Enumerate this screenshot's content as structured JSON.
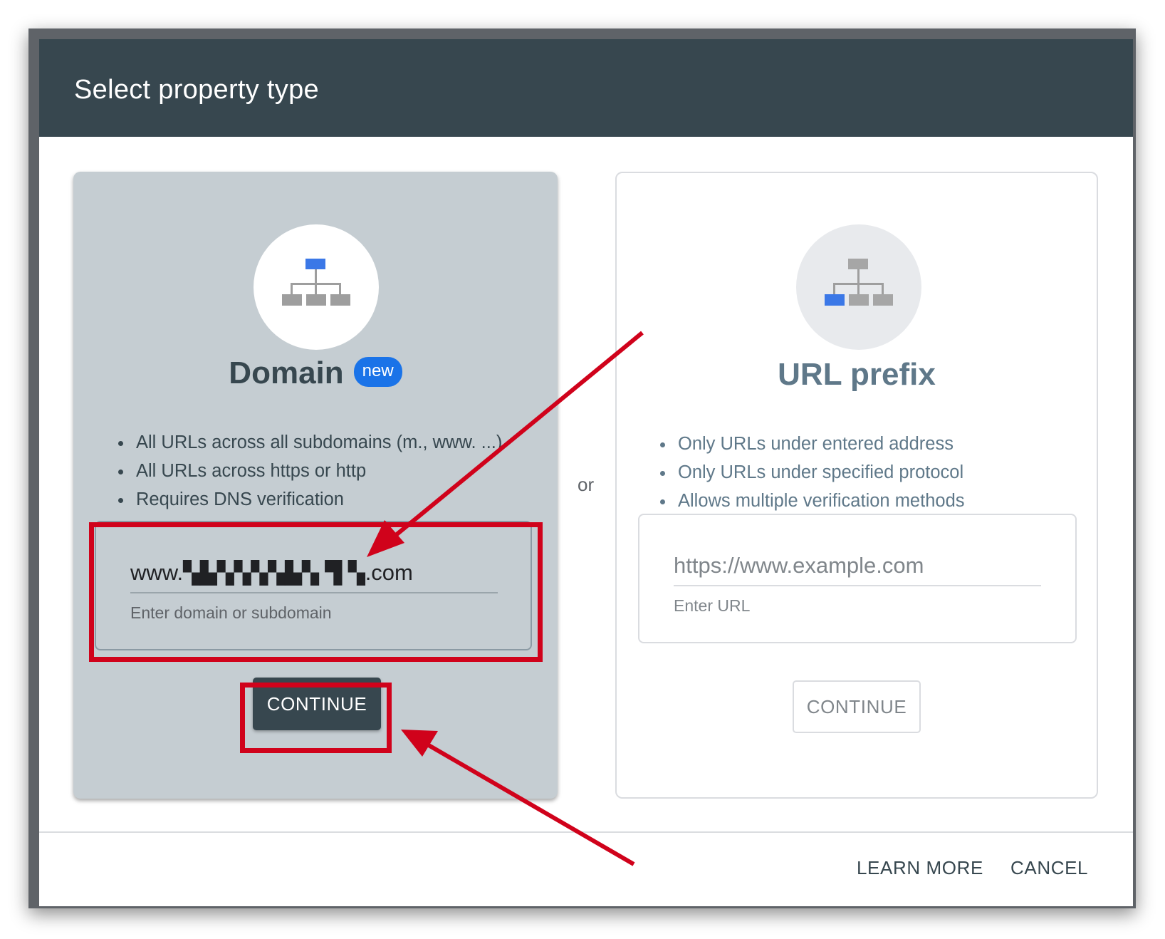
{
  "dialog": {
    "title": "Select property type"
  },
  "domain_card": {
    "title": "Domain",
    "badge": "new",
    "features": [
      "All URLs across all subdomains (m., www. ...)",
      "All URLs across https or http",
      "Requires DNS verification"
    ],
    "input_value": "www.▚▙▚▚▚▚▙▚ ▜ ▚.com",
    "input_helper": "Enter domain or subdomain",
    "continue_label": "CONTINUE",
    "icon": "sitemap-icon",
    "highlight_color": "#1a73e8"
  },
  "separator": "or",
  "url_card": {
    "title": "URL prefix",
    "features": [
      "Only URLs under entered address",
      "Only URLs under specified protocol",
      "Allows multiple verification methods"
    ],
    "input_placeholder": "https://www.example.com",
    "input_helper": "Enter URL",
    "continue_label": "CONTINUE",
    "icon": "sitemap-icon"
  },
  "footer": {
    "learn_more_label": "LEARN MORE",
    "cancel_label": "CANCEL"
  },
  "annotations": {
    "color": "#d0021b"
  }
}
